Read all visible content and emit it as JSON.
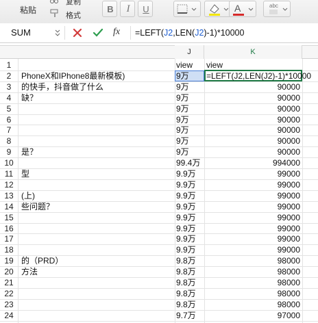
{
  "ribbon": {
    "paste_label": "粘贴",
    "copy_label": "复制",
    "format_label": "格式",
    "bold": "B",
    "italic": "I",
    "underline": "U",
    "pinyin": "abc"
  },
  "formula_bar": {
    "name_box": "SUM",
    "fx": "fx",
    "formula_parts": [
      "=LEFT(",
      "J2",
      ",LEN(",
      "J2",
      ")-1)*10000"
    ]
  },
  "columns": {
    "J": "J",
    "K": "K"
  },
  "k2_formula": "=LEFT(J2,LEN(J2)-1)*10000",
  "rows": [
    {
      "num": "1",
      "i": "",
      "j": "view",
      "k": "view"
    },
    {
      "num": "2",
      "i": "PhoneX和IPhone8最新模板)",
      "j": "9万",
      "k": ""
    },
    {
      "num": "3",
      "i": "的快手，抖音做了什么",
      "j": "9万",
      "k": "90000"
    },
    {
      "num": "4",
      "i": "缺？",
      "j": "9万",
      "k": "90000"
    },
    {
      "num": "5",
      "i": "",
      "j": "9万",
      "k": "90000"
    },
    {
      "num": "6",
      "i": "",
      "j": "9万",
      "k": "90000"
    },
    {
      "num": "7",
      "i": "",
      "j": "9万",
      "k": "90000"
    },
    {
      "num": "8",
      "i": "",
      "j": "9万",
      "k": "90000"
    },
    {
      "num": "9",
      "i": "是？",
      "j": "9万",
      "k": "90000"
    },
    {
      "num": "10",
      "i": "",
      "j": "99.4万",
      "k": "994000"
    },
    {
      "num": "11",
      "i": "型",
      "j": "9.9万",
      "k": "99000"
    },
    {
      "num": "12",
      "i": "",
      "j": "9.9万",
      "k": "99000"
    },
    {
      "num": "13",
      "i": "(上)",
      "j": "9.9万",
      "k": "99000"
    },
    {
      "num": "14",
      "i": "些问题？",
      "j": "9.9万",
      "k": "99000"
    },
    {
      "num": "15",
      "i": "",
      "j": "9.9万",
      "k": "99000"
    },
    {
      "num": "16",
      "i": "",
      "j": "9.9万",
      "k": "99000"
    },
    {
      "num": "17",
      "i": "",
      "j": "9.9万",
      "k": "99000"
    },
    {
      "num": "18",
      "i": "",
      "j": "9.9万",
      "k": "99000"
    },
    {
      "num": "19",
      "i": "的（PRD）",
      "j": "9.8万",
      "k": "98000"
    },
    {
      "num": "20",
      "i": "方法",
      "j": "9.8万",
      "k": "98000"
    },
    {
      "num": "21",
      "i": "",
      "j": "9.8万",
      "k": "98000"
    },
    {
      "num": "22",
      "i": "",
      "j": "9.8万",
      "k": "98000"
    },
    {
      "num": "23",
      "i": "",
      "j": "9.8万",
      "k": "98000"
    },
    {
      "num": "24",
      "i": "",
      "j": "9.7万",
      "k": "97000"
    }
  ],
  "colors": {
    "accent_green": "#1e7a45",
    "ref_blue": "#1f5fd0",
    "cancel_red": "#d23b3b",
    "confirm_green": "#2e9e4f"
  }
}
